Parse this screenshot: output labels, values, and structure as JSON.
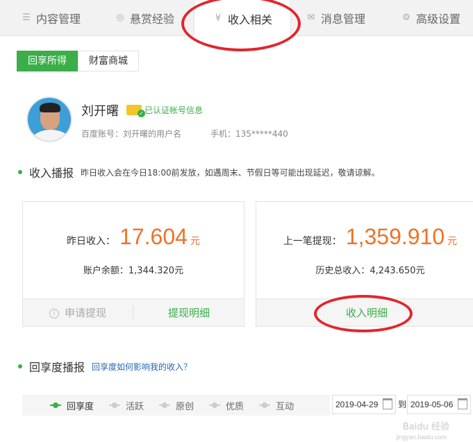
{
  "tabs": [
    {
      "label": "内容管理",
      "icon": "list-icon"
    },
    {
      "label": "悬赏经验",
      "icon": "coin-icon"
    },
    {
      "label": "收入相关",
      "icon": "yuan-icon",
      "active": true
    },
    {
      "label": "消息管理",
      "icon": "mail-icon"
    },
    {
      "label": "高级设置",
      "icon": "gear-icon"
    }
  ],
  "subtabs": [
    {
      "label": "回享所得",
      "active": true
    },
    {
      "label": "财富商城",
      "active": false
    }
  ],
  "profile": {
    "name": "刘开曙",
    "verify_text": "已认证帐号信息",
    "account": "百度账号：刘开曙的用户名",
    "phone": "手机：135*****440"
  },
  "income_section": {
    "title": "收入播报",
    "note": "昨日收入会在今日18:00前发放，如遇周末、节假日等可能出现延迟，敬请谅解。"
  },
  "card_left": {
    "label": "昨日收入：",
    "amount": "17.604",
    "unit": "元",
    "sub": "账户余额：1,344.320元",
    "btn_withdraw": "申请提现",
    "btn_detail": "提现明细"
  },
  "card_right": {
    "label": "上一笔提现：",
    "amount": "1,359.910",
    "unit": "元",
    "sub": "历史总收入：4,243.650元",
    "btn_detail": "收入明细"
  },
  "share_section": {
    "title": "回享度播报",
    "link": "回享度如何影响我的收入？"
  },
  "metrics": [
    "回享度",
    "活跃",
    "原创",
    "优质",
    "互动"
  ],
  "date_range": {
    "start": "2019-04-29",
    "to": "到",
    "end": "2019-05-06"
  },
  "watermark": {
    "main": "Baidu 经验",
    "sub": "jingyan.baidu.com"
  },
  "colors": {
    "accent_green": "#3aae48",
    "amount_orange": "#f07126",
    "annotation_red": "#e0262c",
    "link_blue": "#2468b4"
  }
}
